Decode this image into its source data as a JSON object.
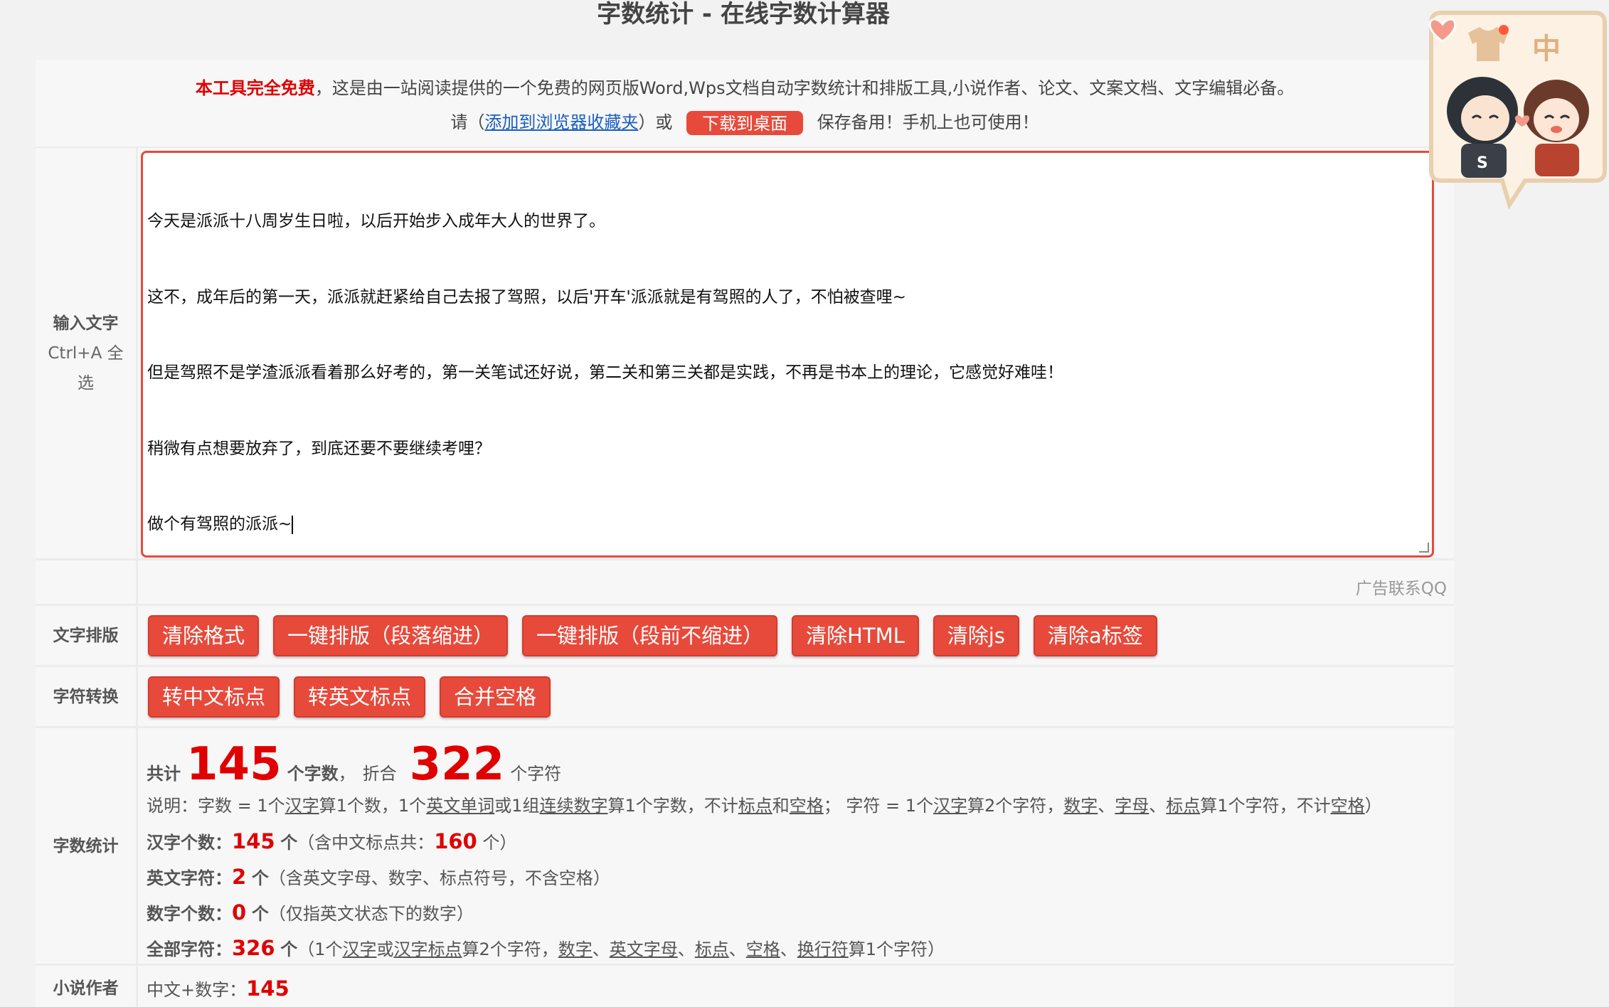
{
  "page_title": "字数统计 - 在线字数计算器",
  "intro": {
    "free_label": "本工具完全免费",
    "description": "，这是由一站阅读提供的一个免费的网页版Word,Wps文档自动字数统计和排版工具,小说作者、论文、文案文档、文字编辑必备。",
    "please": "请（",
    "bookmark_link": "添加到浏览器收藏夹",
    "or": "）或",
    "download_button": "下载到桌面",
    "save_note": "保存备用！手机上也可使用！"
  },
  "input_section": {
    "label": "输入文字",
    "hint_line1": "Ctrl+A 全",
    "hint_line2": "选",
    "text_lines": [
      "今天是派派十八周岁生日啦，以后开始步入成年大人的世界了。",
      "这不，成年后的第一天，派派就赶紧给自己去报了驾照，以后'开车'派派就是有驾照的人了，不怕被查哩~",
      "但是驾照不是学渣派派看着那么好考的，第一关笔试还好说，第二关和第三关都是实践，不再是书本上的理论，它感觉好难哇！",
      "稍微有点想要放弃了，到底还要不要继续考哩？",
      "做个有驾照的派派~"
    ]
  },
  "ad": {
    "text": "广告联系QQ"
  },
  "layout_section": {
    "label": "文字排版",
    "buttons": [
      "清除格式",
      "一键排版（段落缩进）",
      "一键排版（段前不缩进）",
      "清除HTML",
      "清除js",
      "清除a标签"
    ]
  },
  "convert_section": {
    "label": "字符转换",
    "buttons": [
      "转中文标点",
      "转英文标点",
      "合并空格"
    ]
  },
  "stats_section": {
    "label": "字数统计",
    "total_prefix": "共计",
    "word_count": "145",
    "word_unit": "个字数",
    "comma": "，",
    "equiv": "折合",
    "char_count": "322",
    "char_unit": "个字符",
    "explain": {
      "p1": "说明：字数 = 1个",
      "hanzi": "汉字",
      "p2": "算1个数，1个",
      "en_word": "英文单词",
      "p3": "或1组",
      "digits": "连续数字",
      "p4": "算1个字数，不计",
      "punct": "标点",
      "and": "和",
      "space": "空格",
      "p5": "；  字符 = 1个",
      "hanzi2": "汉字",
      "p6": "算2个字符，",
      "num": "数字",
      "dun1": "、",
      "letter": "字母",
      "dun2": "、",
      "punct2": "标点",
      "p7": "算1个字符，不计",
      "space2": "空格",
      "p8": "）"
    },
    "hanzi_count": {
      "key": "汉字个数：",
      "value": "145",
      "unit": "个",
      "note_prefix": "（含中文标点共：",
      "note_value": "160",
      "note_suffix": " 个）"
    },
    "english_count": {
      "key": "英文字符：",
      "value": "2",
      "unit": "个",
      "note": "（含英文字母、数字、标点符号，不含空格）"
    },
    "digit_count": {
      "key": "数字个数：",
      "value": "0",
      "unit": "个",
      "note": "（仅指英文状态下的数字）"
    },
    "all_count": {
      "key": "全部字符：",
      "value": "326",
      "unit": "个",
      "n1": "（1个",
      "hanzi": "汉字",
      "or": "或",
      "hanzi_punct": "汉字标点",
      "n2": "算2个字符，",
      "num": "数字",
      "d1": "、",
      "en_letter": "英文字母",
      "d2": "、",
      "punct": "标点",
      "d3": "、",
      "space": "空格",
      "d4": "、",
      "newline": "换行符",
      "n3": "算1个字符）"
    }
  },
  "novel_section": {
    "label": "小说作者",
    "key": "中文+数字：",
    "value": "145"
  },
  "widget": {
    "shirt_icon": "shirt-icon",
    "lang_label": "中",
    "colors": {
      "bubble": "#fdf1e4",
      "border": "#e8cfae",
      "accent": "#e0b080",
      "dot": "#ff5a3c"
    }
  }
}
